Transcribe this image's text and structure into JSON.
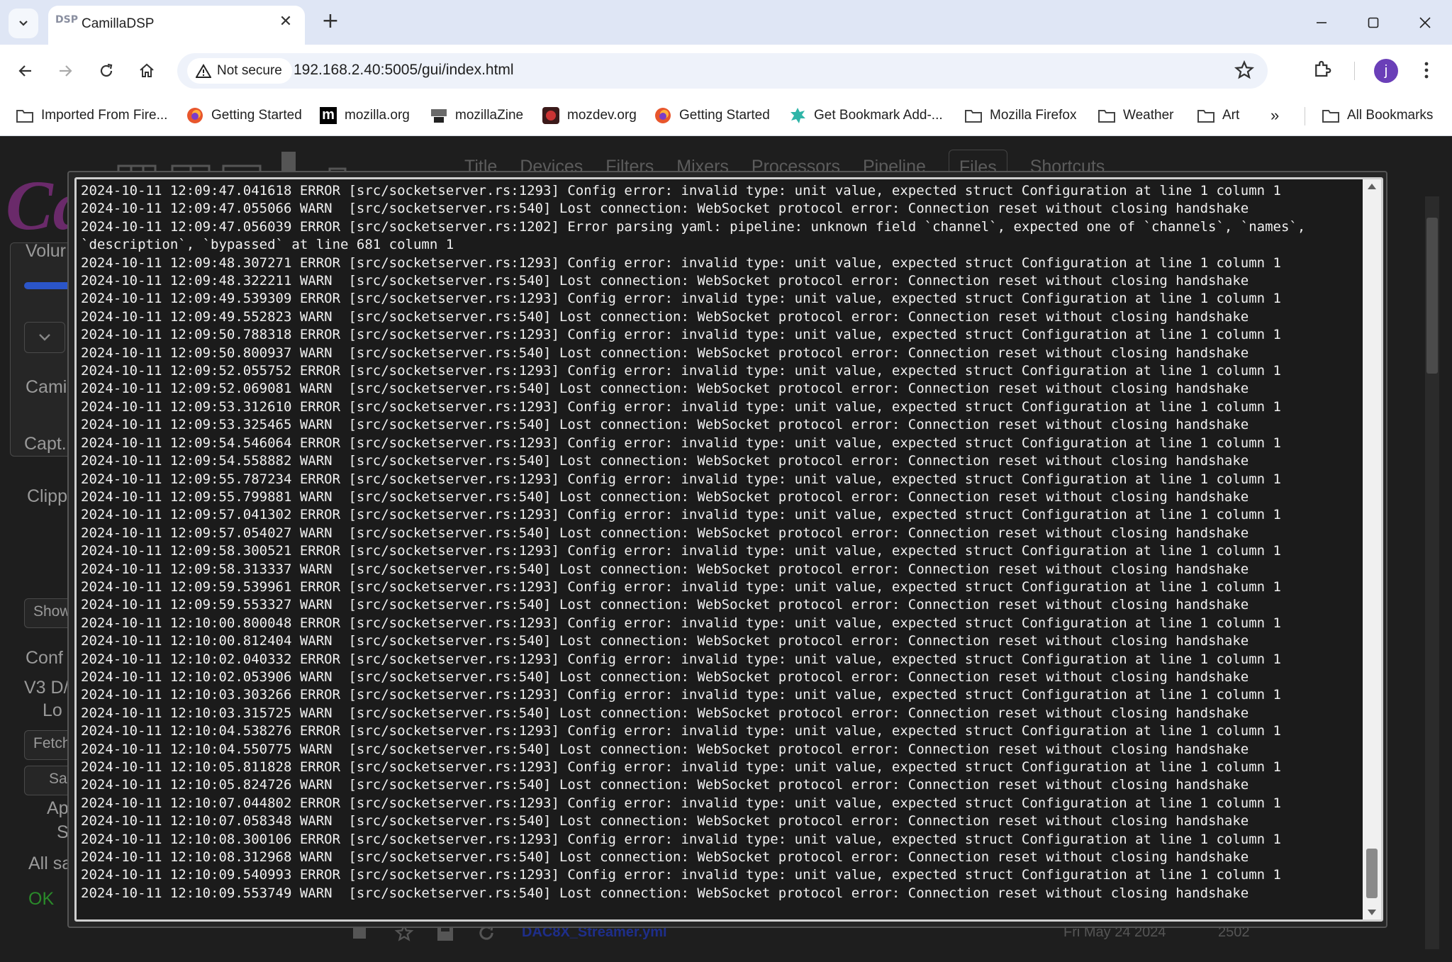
{
  "browser": {
    "tab_title": "CamillaDSP",
    "tab_favicon_text": "DSP",
    "security_label": "Not secure",
    "url": "192.168.2.40:5005/gui/index.html",
    "profile_initial": "j"
  },
  "bookmarks": [
    {
      "label": "Imported From Fire...",
      "icon": "folder-icon"
    },
    {
      "label": "Getting Started",
      "icon": "firefox-icon"
    },
    {
      "label": "mozilla.org",
      "icon": "mozilla-icon"
    },
    {
      "label": "mozillaZine",
      "icon": "mozillazine-icon"
    },
    {
      "label": "mozdev.org",
      "icon": "mozdev-icon"
    },
    {
      "label": "Getting Started",
      "icon": "firefox-icon"
    },
    {
      "label": "Get Bookmark Add-...",
      "icon": "addon-icon"
    },
    {
      "label": "Mozilla Firefox",
      "icon": "folder-icon"
    },
    {
      "label": "Weather",
      "icon": "folder-icon"
    },
    {
      "label": "Art",
      "icon": "folder-icon"
    }
  ],
  "bookmarks_overflow": "»",
  "all_bookmarks": "All Bookmarks",
  "app": {
    "tabs": [
      "Title",
      "Devices",
      "Filters",
      "Mixers",
      "Processors",
      "Pipeline",
      "Files",
      "Shortcuts"
    ],
    "active_tab": "Files",
    "sidebar": {
      "logo": "Ca",
      "volume": "Volur",
      "camilla": "Cami",
      "capture": "Capt.",
      "clipped": "Clipp",
      "show": "Show",
      "config": "Conf",
      "config_name_1": "V3 D/",
      "config_name_2": "Lo",
      "fetch": "Fetch",
      "save": "Sa",
      "apply": "Ap",
      "s": "S",
      "all_saved": "All sa",
      "ok": "OK"
    },
    "bottom": {
      "file_name": "DAC8X_Streamer.yml",
      "date": "Fri May 24 2024",
      "number": "2502"
    }
  },
  "log_lines": [
    "2024-10-11 12:09:47.041618 ERROR [src/socketserver.rs:1293] Config error: invalid type: unit value, expected struct Configuration at line 1 column 1",
    "2024-10-11 12:09:47.055066 WARN  [src/socketserver.rs:540] Lost connection: WebSocket protocol error: Connection reset without closing handshake",
    "2024-10-11 12:09:47.056039 ERROR [src/socketserver.rs:1202] Error parsing yaml: pipeline: unknown field `channel`, expected one of `channels`, `names`,",
    "`description`, `bypassed` at line 681 column 1",
    "2024-10-11 12:09:48.307271 ERROR [src/socketserver.rs:1293] Config error: invalid type: unit value, expected struct Configuration at line 1 column 1",
    "2024-10-11 12:09:48.322211 WARN  [src/socketserver.rs:540] Lost connection: WebSocket protocol error: Connection reset without closing handshake",
    "2024-10-11 12:09:49.539309 ERROR [src/socketserver.rs:1293] Config error: invalid type: unit value, expected struct Configuration at line 1 column 1",
    "2024-10-11 12:09:49.552823 WARN  [src/socketserver.rs:540] Lost connection: WebSocket protocol error: Connection reset without closing handshake",
    "2024-10-11 12:09:50.788318 ERROR [src/socketserver.rs:1293] Config error: invalid type: unit value, expected struct Configuration at line 1 column 1",
    "2024-10-11 12:09:50.800937 WARN  [src/socketserver.rs:540] Lost connection: WebSocket protocol error: Connection reset without closing handshake",
    "2024-10-11 12:09:52.055752 ERROR [src/socketserver.rs:1293] Config error: invalid type: unit value, expected struct Configuration at line 1 column 1",
    "2024-10-11 12:09:52.069081 WARN  [src/socketserver.rs:540] Lost connection: WebSocket protocol error: Connection reset without closing handshake",
    "2024-10-11 12:09:53.312610 ERROR [src/socketserver.rs:1293] Config error: invalid type: unit value, expected struct Configuration at line 1 column 1",
    "2024-10-11 12:09:53.325465 WARN  [src/socketserver.rs:540] Lost connection: WebSocket protocol error: Connection reset without closing handshake",
    "2024-10-11 12:09:54.546064 ERROR [src/socketserver.rs:1293] Config error: invalid type: unit value, expected struct Configuration at line 1 column 1",
    "2024-10-11 12:09:54.558882 WARN  [src/socketserver.rs:540] Lost connection: WebSocket protocol error: Connection reset without closing handshake",
    "2024-10-11 12:09:55.787234 ERROR [src/socketserver.rs:1293] Config error: invalid type: unit value, expected struct Configuration at line 1 column 1",
    "2024-10-11 12:09:55.799881 WARN  [src/socketserver.rs:540] Lost connection: WebSocket protocol error: Connection reset without closing handshake",
    "2024-10-11 12:09:57.041302 ERROR [src/socketserver.rs:1293] Config error: invalid type: unit value, expected struct Configuration at line 1 column 1",
    "2024-10-11 12:09:57.054027 WARN  [src/socketserver.rs:540] Lost connection: WebSocket protocol error: Connection reset without closing handshake",
    "2024-10-11 12:09:58.300521 ERROR [src/socketserver.rs:1293] Config error: invalid type: unit value, expected struct Configuration at line 1 column 1",
    "2024-10-11 12:09:58.313337 WARN  [src/socketserver.rs:540] Lost connection: WebSocket protocol error: Connection reset without closing handshake",
    "2024-10-11 12:09:59.539961 ERROR [src/socketserver.rs:1293] Config error: invalid type: unit value, expected struct Configuration at line 1 column 1",
    "2024-10-11 12:09:59.553327 WARN  [src/socketserver.rs:540] Lost connection: WebSocket protocol error: Connection reset without closing handshake",
    "2024-10-11 12:10:00.800048 ERROR [src/socketserver.rs:1293] Config error: invalid type: unit value, expected struct Configuration at line 1 column 1",
    "2024-10-11 12:10:00.812404 WARN  [src/socketserver.rs:540] Lost connection: WebSocket protocol error: Connection reset without closing handshake",
    "2024-10-11 12:10:02.040332 ERROR [src/socketserver.rs:1293] Config error: invalid type: unit value, expected struct Configuration at line 1 column 1",
    "2024-10-11 12:10:02.053906 WARN  [src/socketserver.rs:540] Lost connection: WebSocket protocol error: Connection reset without closing handshake",
    "2024-10-11 12:10:03.303266 ERROR [src/socketserver.rs:1293] Config error: invalid type: unit value, expected struct Configuration at line 1 column 1",
    "2024-10-11 12:10:03.315725 WARN  [src/socketserver.rs:540] Lost connection: WebSocket protocol error: Connection reset without closing handshake",
    "2024-10-11 12:10:04.538276 ERROR [src/socketserver.rs:1293] Config error: invalid type: unit value, expected struct Configuration at line 1 column 1",
    "2024-10-11 12:10:04.550775 WARN  [src/socketserver.rs:540] Lost connection: WebSocket protocol error: Connection reset without closing handshake",
    "2024-10-11 12:10:05.811828 ERROR [src/socketserver.rs:1293] Config error: invalid type: unit value, expected struct Configuration at line 1 column 1",
    "2024-10-11 12:10:05.824726 WARN  [src/socketserver.rs:540] Lost connection: WebSocket protocol error: Connection reset without closing handshake",
    "2024-10-11 12:10:07.044802 ERROR [src/socketserver.rs:1293] Config error: invalid type: unit value, expected struct Configuration at line 1 column 1",
    "2024-10-11 12:10:07.058348 WARN  [src/socketserver.rs:540] Lost connection: WebSocket protocol error: Connection reset without closing handshake",
    "2024-10-11 12:10:08.300106 ERROR [src/socketserver.rs:1293] Config error: invalid type: unit value, expected struct Configuration at line 1 column 1",
    "2024-10-11 12:10:08.312968 WARN  [src/socketserver.rs:540] Lost connection: WebSocket protocol error: Connection reset without closing handshake",
    "2024-10-11 12:10:09.540993 ERROR [src/socketserver.rs:1293] Config error: invalid type: unit value, expected struct Configuration at line 1 column 1",
    "2024-10-11 12:10:09.553749 WARN  [src/socketserver.rs:540] Lost connection: WebSocket protocol error: Connection reset without closing handshake"
  ]
}
